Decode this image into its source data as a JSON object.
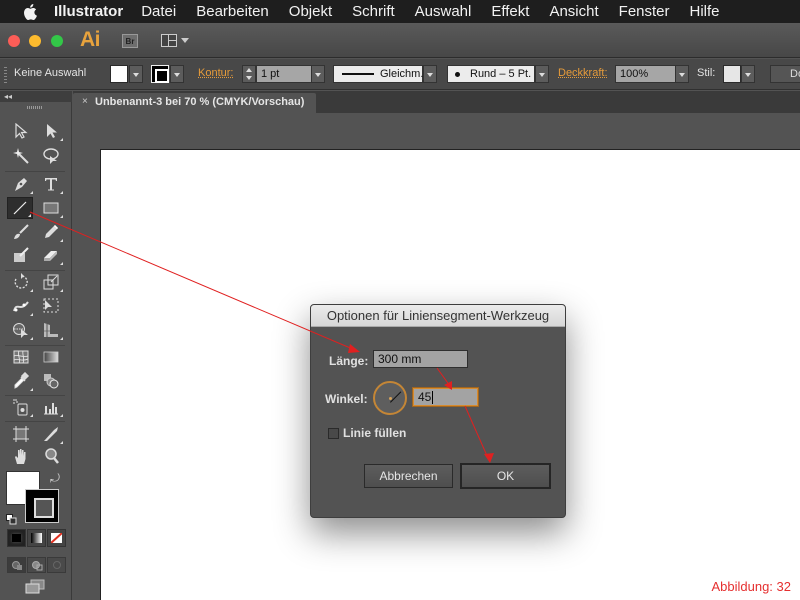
{
  "menubar": {
    "apple_icon": "apple-logo-icon",
    "app_name": "Illustrator",
    "items": [
      "Datei",
      "Bearbeiten",
      "Objekt",
      "Schrift",
      "Auswahl",
      "Effekt",
      "Ansicht",
      "Fenster",
      "Hilfe"
    ]
  },
  "appbar": {
    "logo": "Ai",
    "bridge_label": "Br",
    "workspace_icon": "workspace-layout-icon"
  },
  "control_bar": {
    "selection_status": "Keine Auswahl",
    "fill_color": "#ffffff",
    "stroke_label": "Kontur:",
    "stroke_weight": "1 pt",
    "stroke_profile": "Gleichm.",
    "brush": "Rund – 5 Pt.",
    "opacity_label": "Deckkraft:",
    "opacity_value": "100%",
    "style_label": "Stil:",
    "document_button": "Do"
  },
  "tools_panel": {
    "collapse_icon": "◂◂",
    "tools": [
      {
        "name": "selection-tool",
        "label": "Auswahl"
      },
      {
        "name": "direct-selection-tool",
        "label": "Direktauswahl"
      },
      {
        "name": "magic-wand-tool",
        "label": "Zauberstab"
      },
      {
        "name": "lasso-tool",
        "label": "Lasso"
      },
      {
        "name": "pen-tool",
        "label": "Zeichenstift"
      },
      {
        "name": "type-tool",
        "label": "Text"
      },
      {
        "name": "line-segment-tool",
        "label": "Liniensegment",
        "active": true
      },
      {
        "name": "rectangle-tool",
        "label": "Rechteck"
      },
      {
        "name": "paintbrush-tool",
        "label": "Pinsel"
      },
      {
        "name": "pencil-tool",
        "label": "Buntstift"
      },
      {
        "name": "blob-brush-tool",
        "label": "Tropfenpinsel"
      },
      {
        "name": "eraser-tool",
        "label": "Radiergummi"
      },
      {
        "name": "rotate-tool",
        "label": "Drehen"
      },
      {
        "name": "scale-tool",
        "label": "Skalieren"
      },
      {
        "name": "width-tool",
        "label": "Breite"
      },
      {
        "name": "free-transform-tool",
        "label": "Frei transformieren"
      },
      {
        "name": "shape-builder-tool",
        "label": "Formerstellung"
      },
      {
        "name": "perspective-grid-tool",
        "label": "Perspektivenraster"
      },
      {
        "name": "mesh-tool",
        "label": "Gitter"
      },
      {
        "name": "gradient-tool",
        "label": "Verlauf"
      },
      {
        "name": "eyedropper-tool",
        "label": "Pipette"
      },
      {
        "name": "blend-tool",
        "label": "Angleichen"
      },
      {
        "name": "symbol-sprayer-tool",
        "label": "Symbol-Aufsprühen"
      },
      {
        "name": "column-graph-tool",
        "label": "Säulendiagramm"
      },
      {
        "name": "artboard-tool",
        "label": "Zeichenflächen"
      },
      {
        "name": "slice-tool",
        "label": "Slice"
      },
      {
        "name": "hand-tool",
        "label": "Hand"
      },
      {
        "name": "zoom-tool",
        "label": "Zoom"
      }
    ],
    "fill_color": "#ffffff",
    "stroke_color": "#000000"
  },
  "document": {
    "tab_title": "Unbenannt-3 bei 70 % (CMYK/Vorschau)",
    "close_glyph": "×"
  },
  "dialog": {
    "title": "Optionen für Liniensegment-Werkzeug",
    "length_label": "Länge:",
    "length_value": "300 mm",
    "angle_label": "Winkel:",
    "angle_value": "45",
    "fill_line_label": "Linie füllen",
    "fill_line_checked": false,
    "cancel_label": "Abbrechen",
    "ok_label": "OK"
  },
  "annotation": {
    "caption": "Abbildung: 32",
    "arrow_color": "#e02020"
  }
}
